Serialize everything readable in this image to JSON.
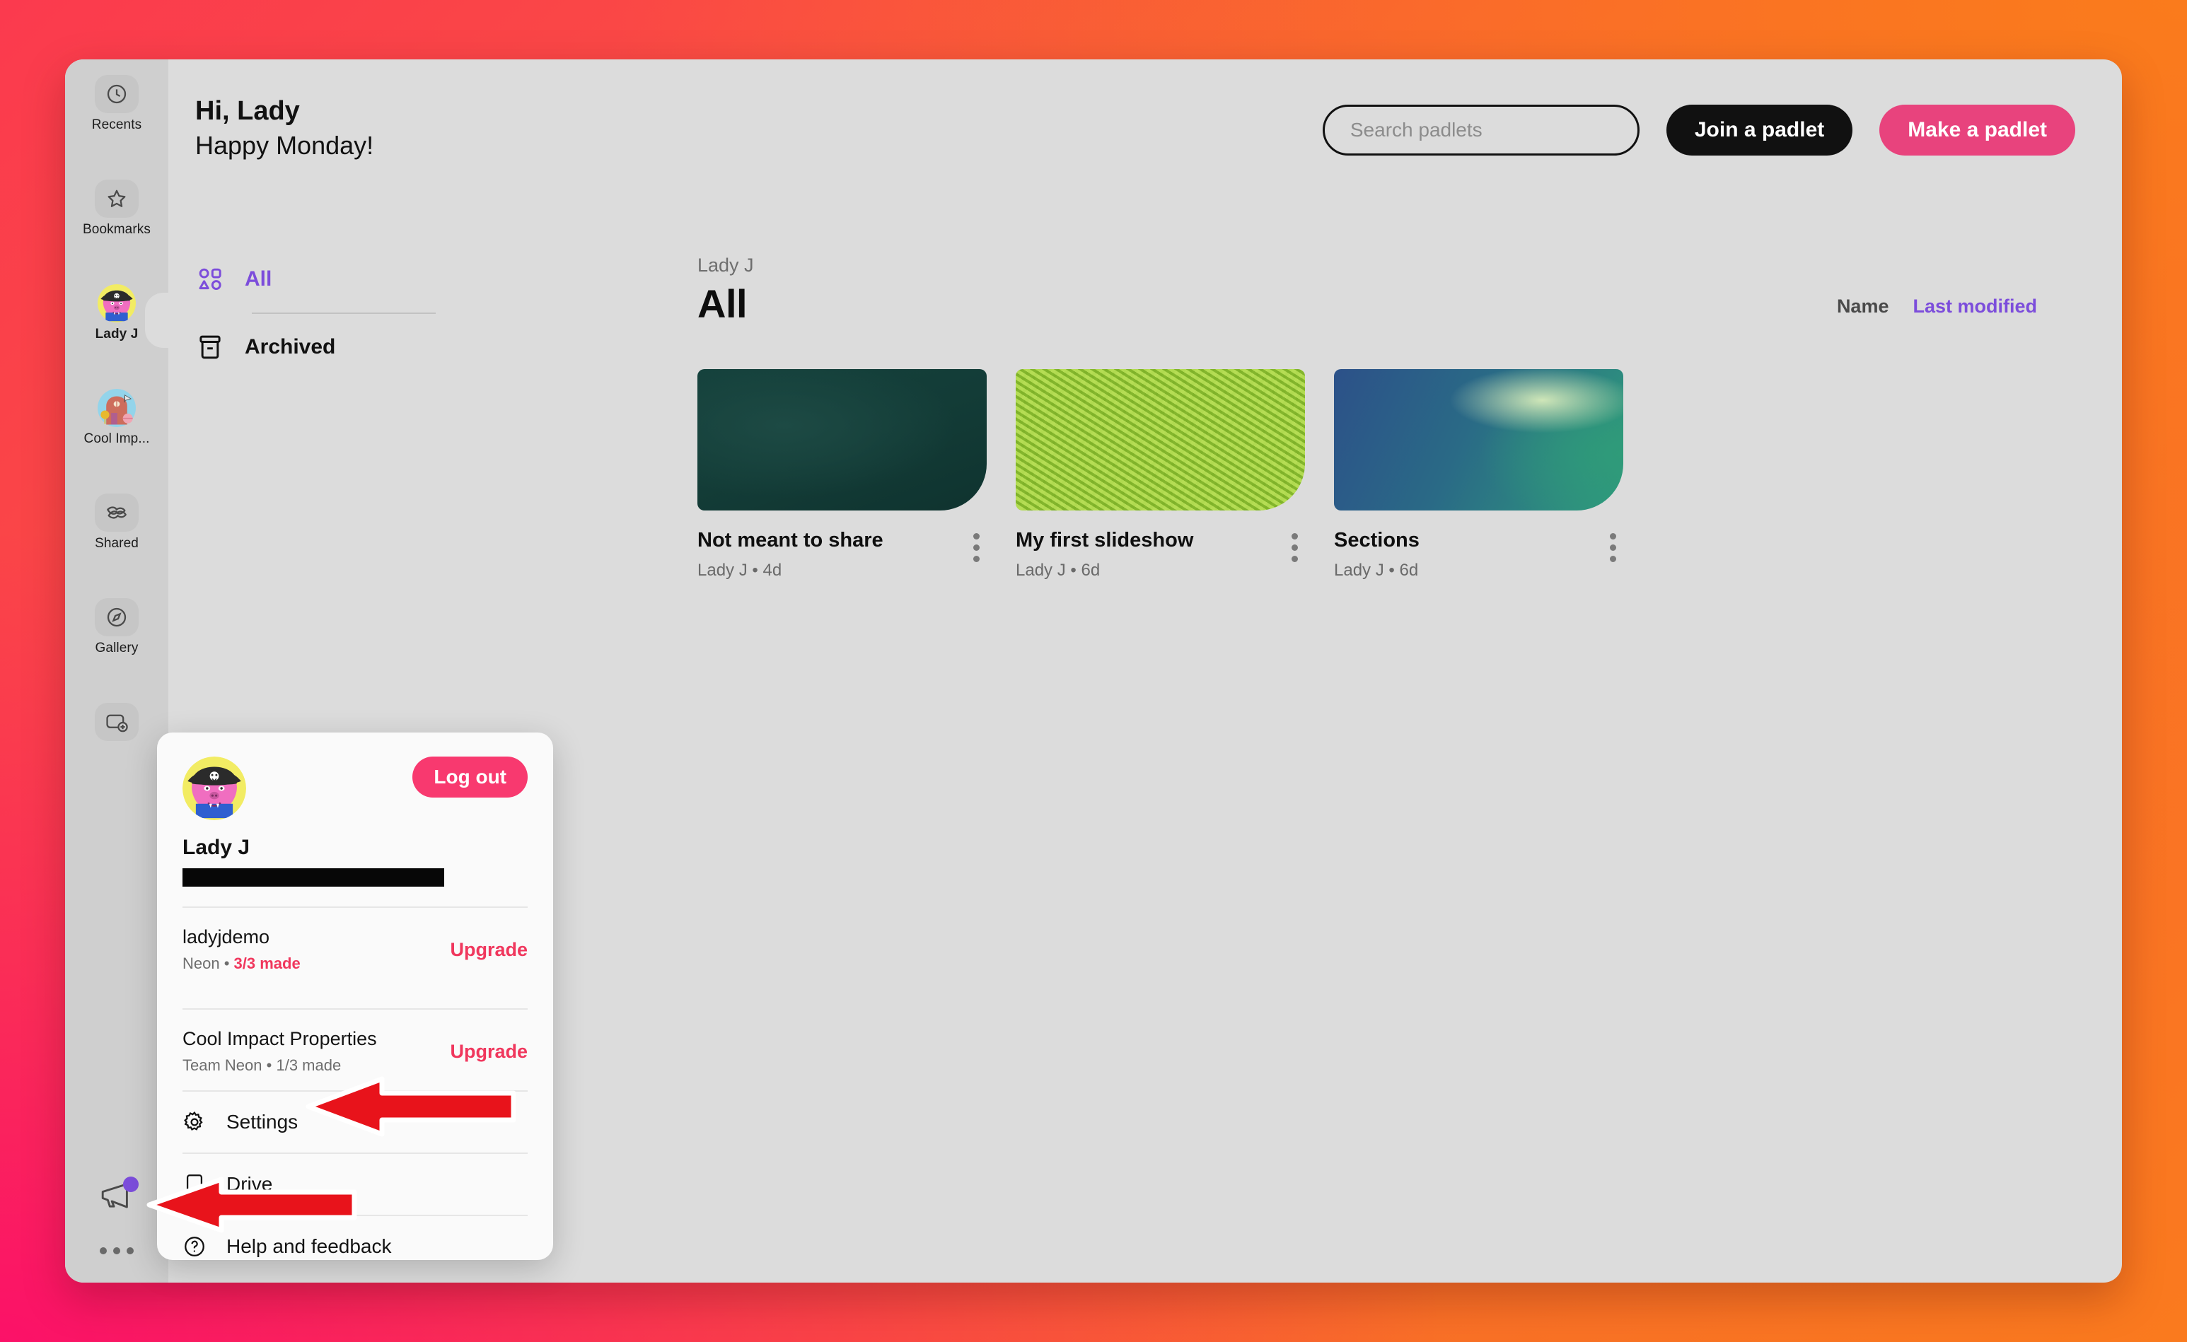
{
  "app": {
    "background_gradient": [
      "#fb3a4e",
      "#f96a2c",
      "#fa7a1e",
      "#fb1168"
    ],
    "surface_color": "#dcdcdc",
    "rail_color": "#cfcfcf",
    "accent_purple": "#7c4ddb",
    "accent_pink": "#e8437d",
    "danger_pink": "#f0375d"
  },
  "rail": {
    "items": [
      {
        "label": "Recents",
        "icon": "clock-icon",
        "kind": "icon",
        "selected": false
      },
      {
        "label": "Bookmarks",
        "icon": "star-icon",
        "kind": "icon",
        "selected": false
      },
      {
        "label": "Lady J",
        "icon": "avatar-pirate-pig",
        "kind": "avatar",
        "selected": true
      },
      {
        "label": "Cool Imp...",
        "icon": "avatar-house",
        "kind": "avatar",
        "selected": false
      },
      {
        "label": "Shared",
        "icon": "shared-hands-icon",
        "kind": "icon",
        "selected": false
      },
      {
        "label": "Gallery",
        "icon": "compass-icon",
        "kind": "icon",
        "selected": false
      }
    ],
    "add_button": {
      "icon": "add-padlet-icon",
      "label": ""
    },
    "bottom": {
      "announcements": {
        "icon": "megaphone-icon",
        "has_badge": true,
        "badge_color": "#7c4ddb"
      },
      "more": {
        "icon": "ellipsis-horizontal-icon"
      }
    }
  },
  "header": {
    "greeting_line1": "Hi, Lady",
    "greeting_line2": "Happy Monday!"
  },
  "search": {
    "placeholder": "Search padlets",
    "value": ""
  },
  "toolbar": {
    "join_label": "Join a padlet",
    "make_label": "Make a padlet"
  },
  "filters": {
    "items": [
      {
        "label": "All",
        "icon": "shapes-grid-icon",
        "active": true
      },
      {
        "label": "Archived",
        "icon": "archive-box-icon",
        "active": false
      }
    ]
  },
  "main": {
    "breadcrumb": "Lady J",
    "title": "All",
    "sorts": [
      {
        "label": "Name",
        "active": false
      },
      {
        "label": "Last modified",
        "active": true
      }
    ],
    "cards": [
      {
        "name": "Not meant to share",
        "owner": "Lady J",
        "separator": "•",
        "modified": "4d",
        "thumb": "dark-green-texture"
      },
      {
        "name": "My first slideshow",
        "owner": "Lady J",
        "separator": "•",
        "modified": "6d",
        "thumb": "lime-green-maze"
      },
      {
        "name": "Sections",
        "owner": "Lady J",
        "separator": "•",
        "modified": "6d",
        "thumb": "blue-teal-gradient"
      }
    ]
  },
  "account_popover": {
    "avatar": "avatar-pirate-pig",
    "logout_label": "Log out",
    "display_name": "Lady J",
    "email_redacted": true,
    "accounts": [
      {
        "name": "ladyjdemo",
        "plan": "Neon",
        "separator": "•",
        "quota": "3/3 made",
        "action_label": "Upgrade"
      },
      {
        "name": "Cool Impact Properties",
        "plan": "Team Neon",
        "separator": "•",
        "quota": "1/3 made",
        "action_label": "Upgrade"
      }
    ],
    "menu": [
      {
        "label": "Settings",
        "icon": "gear-icon"
      },
      {
        "label": "Drive",
        "icon": "drive-tablet-icon"
      },
      {
        "label": "Help and feedback",
        "icon": "question-circle-icon"
      }
    ]
  },
  "annotations": {
    "arrows": [
      {
        "name": "arrow-pointing-to-settings",
        "color": "#e8131b",
        "direction": "left"
      },
      {
        "name": "arrow-pointing-to-more-menu",
        "color": "#e8131b",
        "direction": "left"
      }
    ]
  }
}
